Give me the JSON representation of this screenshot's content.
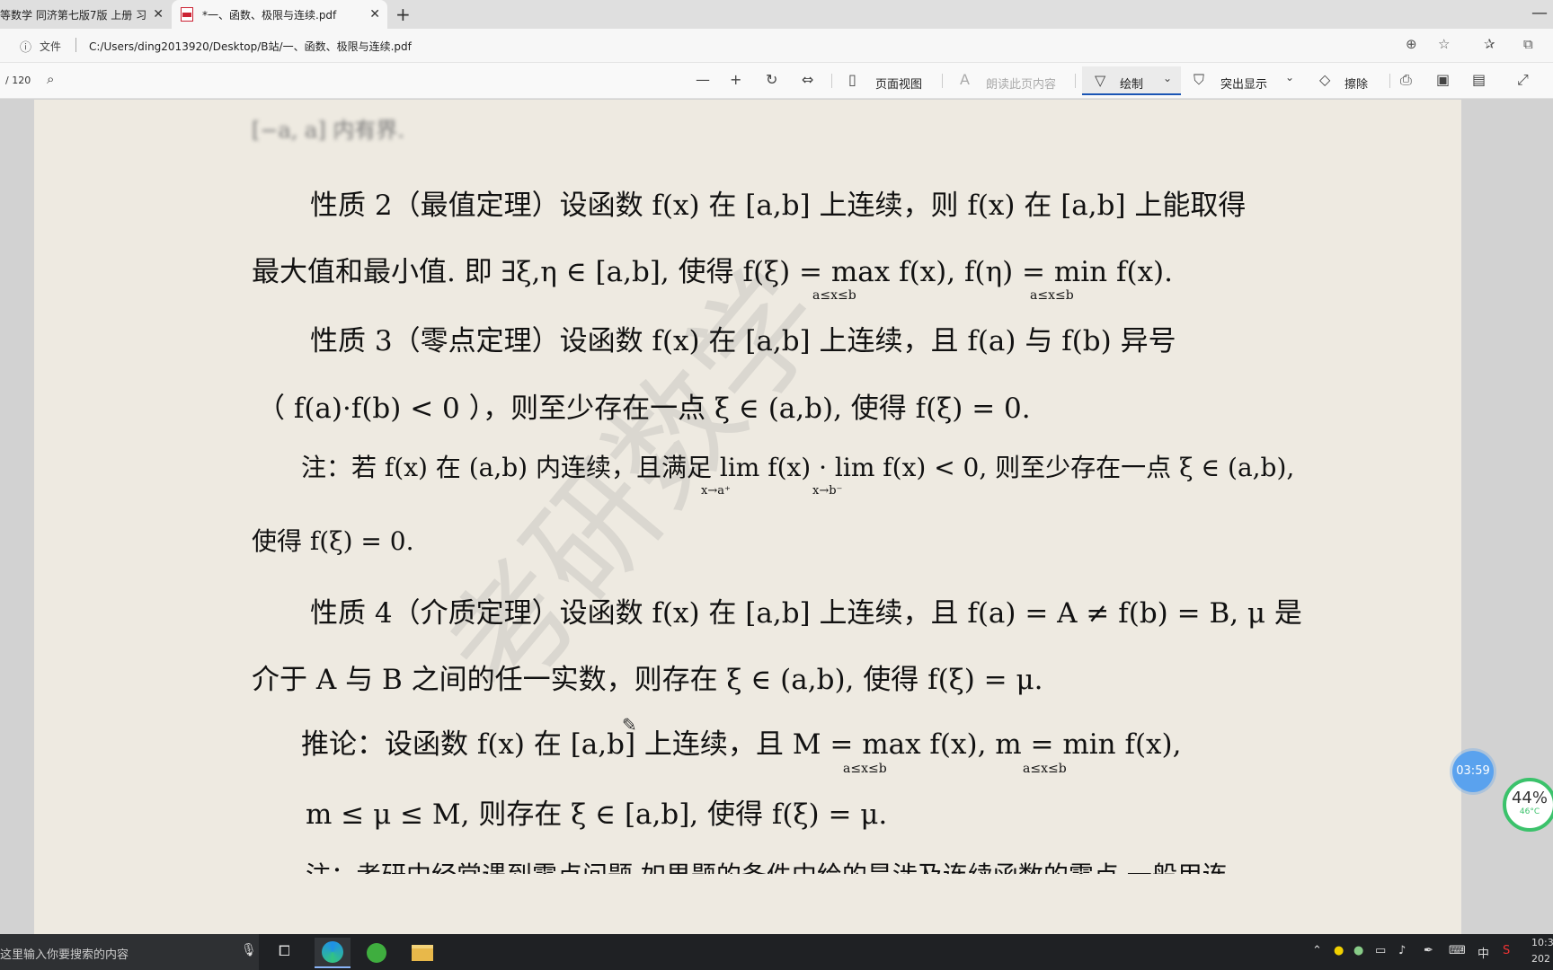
{
  "browser": {
    "tabs": [
      {
        "label": "等数学 同济第七版7版 上册 习",
        "close": "✕"
      },
      {
        "label": "*一、函数、极限与连续.pdf",
        "close": "✕"
      }
    ],
    "new_tab": "+",
    "address": {
      "prefix": "文件",
      "url": "C:/Users/ding2013920/Desktop/B站/一、函数、极限与连续.pdf"
    }
  },
  "toolbar": {
    "page_count": "/ 120",
    "page_view": "页面视图",
    "read_aloud": "朗读此页内容",
    "draw": "绘制",
    "highlight": "突出显示",
    "erase": "擦除"
  },
  "document": {
    "top_partial": "[−a, a] 内有界.",
    "lines": [
      "性质 2（最值定理）设函数 f(x) 在 [a,b] 上连续，则 f(x) 在 [a,b] 上能取得",
      "最大值和最小值. 即 ∃ξ,η ∈ [a,b], 使得 f(ξ) = max f(x), f(η) = min f(x).",
      "性质 3（零点定理）设函数 f(x) 在 [a,b] 上连续，且 f(a) 与 f(b) 异号",
      "（ f(a)·f(b) < 0 ），则至少存在一点 ξ ∈ (a,b), 使得 f(ξ) = 0.",
      "注：若 f(x) 在 (a,b) 内连续，且满足 lim f(x) · lim f(x) < 0, 则至少存在一点 ξ ∈ (a,b),",
      "使得 f(ξ) = 0.",
      "性质 4（介质定理）设函数 f(x) 在 [a,b] 上连续，且 f(a) = A ≠ f(b) = B, μ 是",
      "介于 A 与 B 之间的任一实数，则存在 ξ ∈ (a,b), 使得 f(ξ) = μ.",
      "推论：设函数 f(x) 在 [a,b] 上连续，且 M = max f(x), m = min f(x),",
      "m ≤ μ ≤ M, 则存在 ξ ∈ [a,b], 使得 f(ξ) = μ.",
      "注：考研中经常遇到零点问题,如果题的条件中给的是涉及连续函数的零点,一般用连"
    ],
    "subscripts": {
      "max_range": "a≤x≤b",
      "min_range": "a≤x≤b",
      "lim_right": "x→a⁺",
      "lim_left": "x→b⁻"
    },
    "watermark": "考研数学"
  },
  "overlays": {
    "timer": "03:59",
    "perf_percent": "44%",
    "perf_temp": "46°C"
  },
  "taskbar": {
    "search_placeholder": "这里输入你要搜索的内容",
    "ime": "中",
    "clock_time": "10:3",
    "clock_date": "202"
  }
}
